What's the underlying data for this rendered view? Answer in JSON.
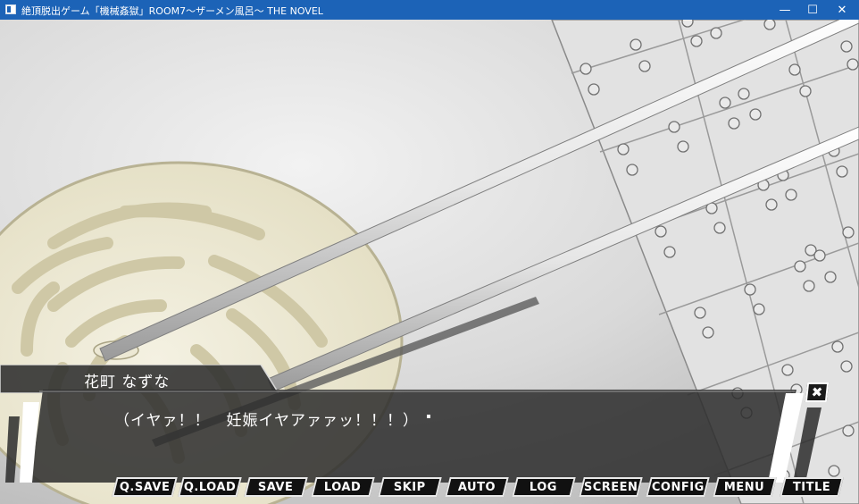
{
  "window": {
    "title": "絶頂脱出ゲーム「機械姦獄」ROOM7〜ザーメン風呂〜 THE NOVEL",
    "minimize_glyph": "—",
    "maximize_glyph": "☐",
    "close_glyph": "✕"
  },
  "dialogue": {
    "speaker": "花町 なずな",
    "text": "（イヤァ！！　妊娠イヤアァァッ！！！）",
    "close_glyph": "✖"
  },
  "menu": {
    "qsave": "Q.SAVE",
    "qload": "Q.LOAD",
    "save": "SAVE",
    "load": "LOAD",
    "skip": "SKIP",
    "auto": "AUTO",
    "log": "LOG",
    "screen": "SCREEN",
    "config": "CONFIG",
    "menu": "MENU",
    "title": "TITLE"
  }
}
